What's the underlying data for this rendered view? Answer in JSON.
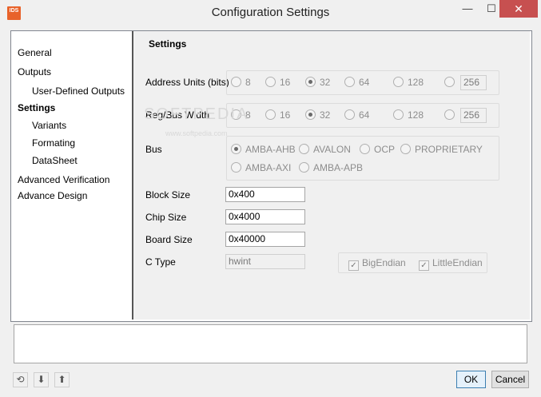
{
  "window": {
    "title": "Configuration Settings",
    "app_icon_text": "IDS",
    "minimize": "—",
    "maximize": "☐",
    "close": "✕"
  },
  "nav": {
    "general": "General",
    "outputs": "Outputs",
    "user_defined_outputs": "User-Defined Outputs",
    "settings": "Settings",
    "variants": "Variants",
    "formating": "Formating",
    "datasheet": "DataSheet",
    "advanced_verification": "Advanced Verification",
    "advance_design": "Advance Design"
  },
  "settings": {
    "title": "Settings",
    "address_units": {
      "label": "Address Units (bits)",
      "options": [
        "8",
        "16",
        "32",
        "64",
        "128"
      ],
      "selected": "32",
      "custom_value": "256"
    },
    "reg_bus_width": {
      "label": "Reg/Bus Width",
      "options": [
        "8",
        "16",
        "32",
        "64",
        "128"
      ],
      "selected": "32",
      "custom_value": "256"
    },
    "bus": {
      "label": "Bus",
      "options": [
        "AMBA-AHB",
        "AVALON",
        "OCP",
        "PROPRIETARY",
        "AMBA-AXI",
        "AMBA-APB"
      ],
      "selected": "AMBA-AHB"
    },
    "block_size": {
      "label": "Block Size",
      "value": "0x400"
    },
    "chip_size": {
      "label": "Chip Size",
      "value": "0x4000"
    },
    "board_size": {
      "label": "Board Size",
      "value": "0x40000"
    },
    "c_type": {
      "label": "C Type",
      "value": "hwint"
    },
    "big_endian": {
      "label": "BigEndian",
      "checked": true
    },
    "little_endian": {
      "label": "LittleEndian",
      "checked": true
    }
  },
  "footer": {
    "reset_icon": "⟲",
    "download_icon": "⬇",
    "upload_icon": "⬆",
    "ok": "OK",
    "cancel": "Cancel"
  },
  "watermark": {
    "main": "SOFTPEDIA",
    "sub": "www.softpedia.com"
  }
}
